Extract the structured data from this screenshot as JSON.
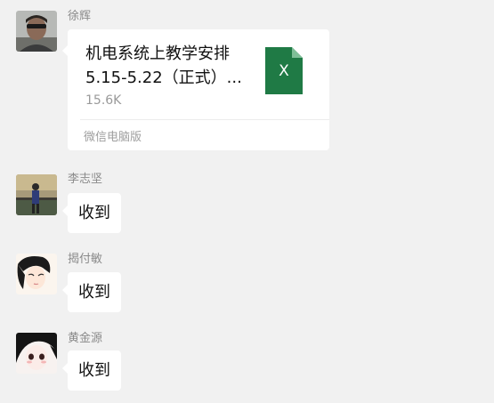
{
  "messages": [
    {
      "sender": "徐辉",
      "file": {
        "name_line1": "机电系统上教学安排",
        "name_line2": "5.15-5.22（正式）...",
        "size": "15.6K",
        "source": "微信电脑版",
        "icon": "excel-file-icon",
        "icon_letter": "X",
        "icon_color": "#1f7a45"
      }
    },
    {
      "sender": "李志坚",
      "text": "收到"
    },
    {
      "sender": "揭付敏",
      "text": "收到"
    },
    {
      "sender": "黄金源",
      "text": "收到"
    }
  ],
  "colors": {
    "background": "#f1f1f1",
    "bubble": "#ffffff",
    "sender": "#8a8a8a"
  }
}
